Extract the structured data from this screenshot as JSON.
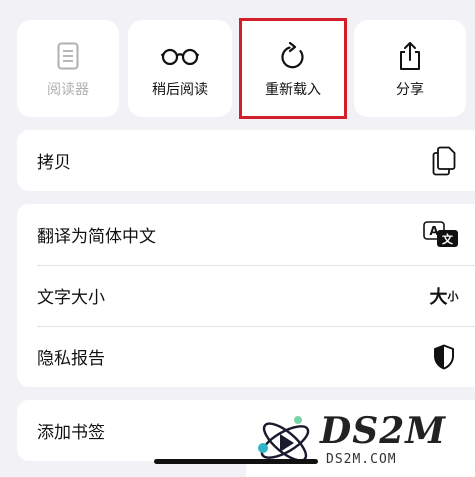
{
  "quick_actions": [
    {
      "label": "阅读器",
      "icon": "document-icon",
      "enabled": false
    },
    {
      "label": "稍后阅读",
      "icon": "glasses-icon",
      "enabled": true
    },
    {
      "label": "重新载入",
      "icon": "reload-icon",
      "enabled": true,
      "highlighted": true
    },
    {
      "label": "分享",
      "icon": "share-icon",
      "enabled": true
    }
  ],
  "menu": {
    "copy": {
      "label": "拷贝",
      "icon": "copy-icon"
    },
    "translate": {
      "label": "翻译为简体中文",
      "icon": "translate-icon",
      "icon_glyph_a": "A",
      "icon_glyph_b": "文"
    },
    "text_size": {
      "label": "文字大小",
      "icon_big": "大",
      "icon_small": "小"
    },
    "privacy": {
      "label": "隐私报告",
      "icon": "shield-icon"
    },
    "bookmark": {
      "label": "添加书签"
    }
  },
  "watermark": {
    "brand": "DS2M",
    "url": "DS2M.COM"
  },
  "colors": {
    "highlight": "#d21f2a",
    "disabled_text": "#b0b0b4",
    "background": "#f2f2f6"
  }
}
